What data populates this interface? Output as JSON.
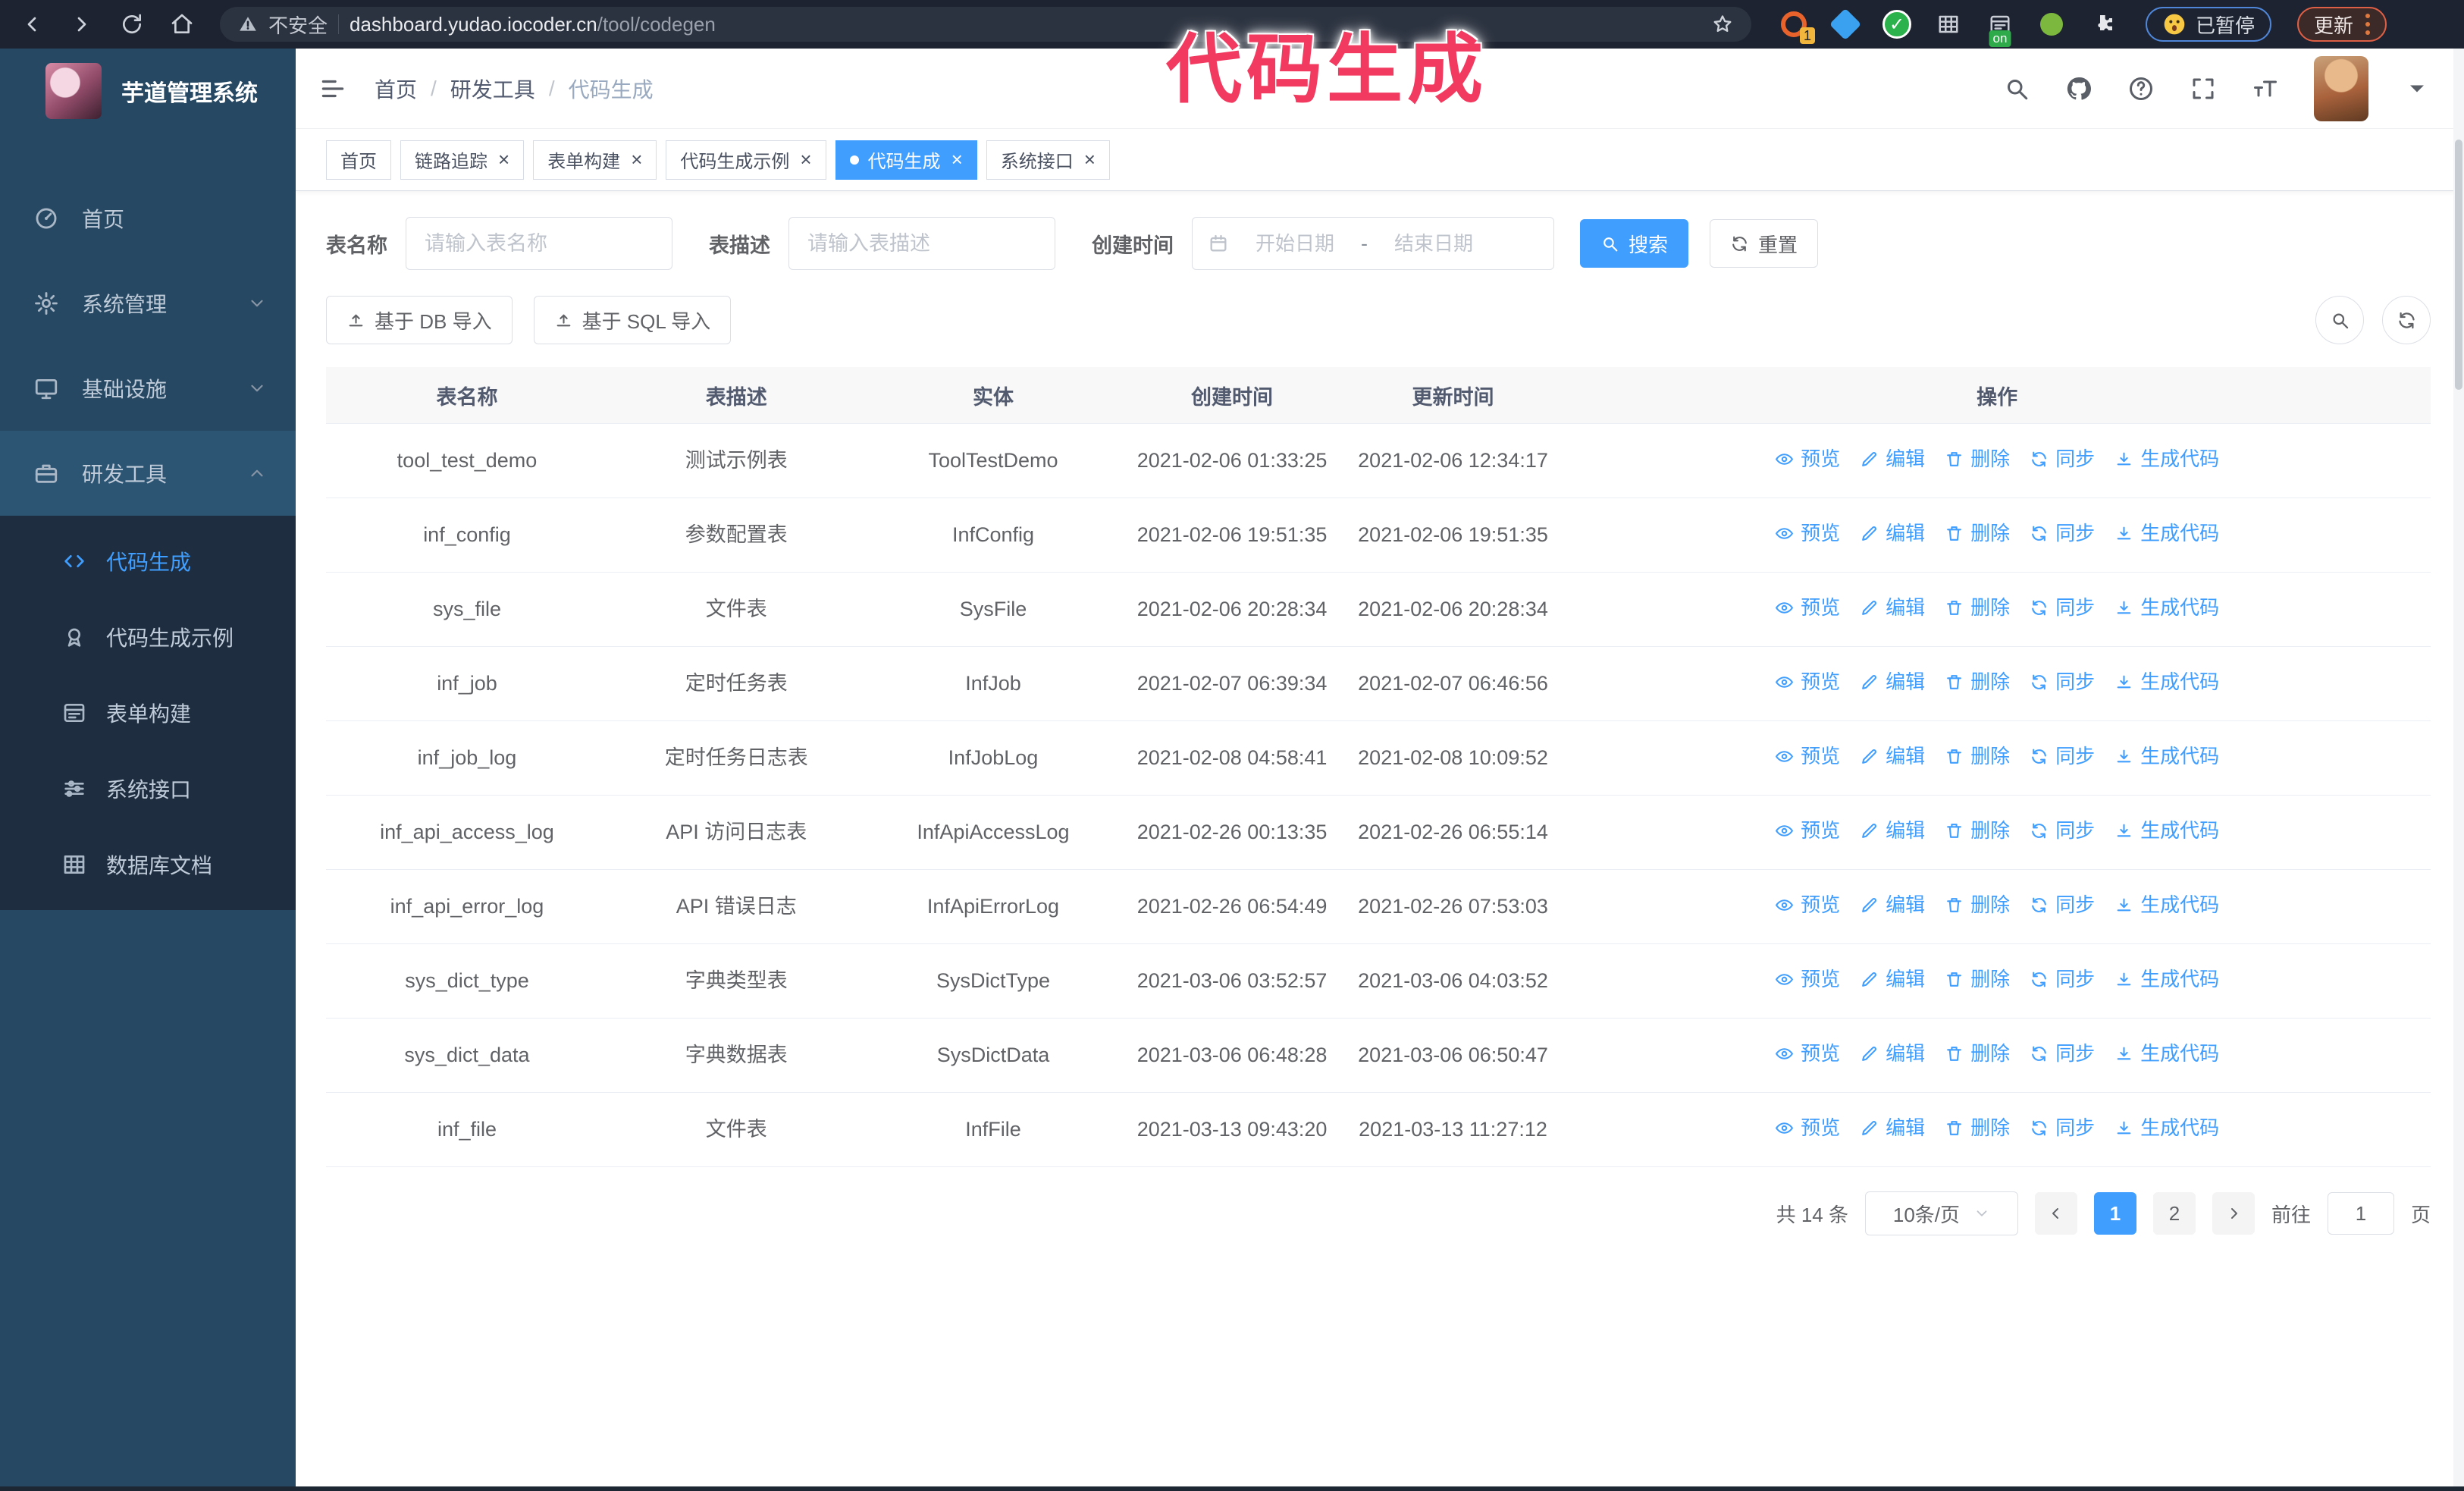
{
  "overlay": {
    "label": "代码生成"
  },
  "colors": {
    "accent": "#409eff",
    "sidebar_bg": "#264863",
    "submenu_bg": "#1e2e40",
    "overlay_pink": "#f23a60",
    "active_tab_bg": "#409eff"
  },
  "browser": {
    "security_warning": "不安全",
    "url_host": "dashboard.yudao.iocoder.cn",
    "url_path": "/tool/codegen",
    "extension_badge_1": "1",
    "extension_on_badge": "on",
    "paused_badge": "已暂停",
    "update_button": "更新"
  },
  "sidebar": {
    "app_title": "芋道管理系统",
    "items": [
      {
        "key": "home",
        "label": "首页",
        "icon": "dashboard-icon",
        "chevron": ""
      },
      {
        "key": "system",
        "label": "系统管理",
        "icon": "gear-icon",
        "chevron": "down"
      },
      {
        "key": "infra",
        "label": "基础设施",
        "icon": "monitor-icon",
        "chevron": "down"
      },
      {
        "key": "devtools",
        "label": "研发工具",
        "icon": "briefcase-icon",
        "chevron": "up",
        "active": true
      }
    ],
    "submenu": [
      {
        "key": "codegen",
        "label": "代码生成",
        "icon": "code-icon",
        "active": true
      },
      {
        "key": "codegen-example",
        "label": "代码生成示例",
        "icon": "medal-icon",
        "active": false
      },
      {
        "key": "form-builder",
        "label": "表单构建",
        "icon": "form-icon",
        "active": false
      },
      {
        "key": "system-api",
        "label": "系统接口",
        "icon": "sliders-icon",
        "active": false
      },
      {
        "key": "db-doc",
        "label": "数据库文档",
        "icon": "table-grid-icon",
        "active": false
      }
    ]
  },
  "navbar": {
    "breadcrumb": [
      "首页",
      "研发工具",
      "代码生成"
    ]
  },
  "tabs": [
    {
      "key": "home",
      "label": "首页",
      "closable": false,
      "active": false
    },
    {
      "key": "tracer",
      "label": "链路追踪",
      "closable": true,
      "active": false
    },
    {
      "key": "form-builder",
      "label": "表单构建",
      "closable": true,
      "active": false
    },
    {
      "key": "codegen-example",
      "label": "代码生成示例",
      "closable": true,
      "active": false
    },
    {
      "key": "codegen",
      "label": "代码生成",
      "closable": true,
      "active": true
    },
    {
      "key": "system-api",
      "label": "系统接口",
      "closable": true,
      "active": false
    }
  ],
  "filters": {
    "table_name_label": "表名称",
    "table_name_placeholder": "请输入表名称",
    "table_desc_label": "表描述",
    "table_desc_placeholder": "请输入表描述",
    "create_time_label": "创建时间",
    "date_start_placeholder": "开始日期",
    "date_separator": "-",
    "date_end_placeholder": "结束日期",
    "search_button": "搜索",
    "reset_button": "重置",
    "import_db_button": "基于 DB 导入",
    "import_sql_button": "基于 SQL 导入"
  },
  "table": {
    "columns": [
      "表名称",
      "表描述",
      "实体",
      "创建时间",
      "更新时间",
      "操作"
    ],
    "actions": [
      "预览",
      "编辑",
      "删除",
      "同步",
      "生成代码"
    ],
    "rows": [
      {
        "name": "tool_test_demo",
        "desc": "测试示例表",
        "entity": "ToolTestDemo",
        "created": "2021-02-06 01:33:25",
        "updated": "2021-02-06 12:34:17"
      },
      {
        "name": "inf_config",
        "desc": "参数配置表",
        "entity": "InfConfig",
        "created": "2021-02-06 19:51:35",
        "updated": "2021-02-06 19:51:35"
      },
      {
        "name": "sys_file",
        "desc": "文件表",
        "entity": "SysFile",
        "created": "2021-02-06 20:28:34",
        "updated": "2021-02-06 20:28:34"
      },
      {
        "name": "inf_job",
        "desc": "定时任务表",
        "entity": "InfJob",
        "created": "2021-02-07 06:39:34",
        "updated": "2021-02-07 06:46:56"
      },
      {
        "name": "inf_job_log",
        "desc": "定时任务日志表",
        "entity": "InfJobLog",
        "created": "2021-02-08 04:58:41",
        "updated": "2021-02-08 10:09:52"
      },
      {
        "name": "inf_api_access_log",
        "desc": "API 访问日志表",
        "entity": "InfApiAccessLog",
        "created": "2021-02-26 00:13:35",
        "updated": "2021-02-26 06:55:14"
      },
      {
        "name": "inf_api_error_log",
        "desc": "API 错误日志",
        "entity": "InfApiErrorLog",
        "created": "2021-02-26 06:54:49",
        "updated": "2021-02-26 07:53:03"
      },
      {
        "name": "sys_dict_type",
        "desc": "字典类型表",
        "entity": "SysDictType",
        "created": "2021-03-06 03:52:57",
        "updated": "2021-03-06 04:03:52"
      },
      {
        "name": "sys_dict_data",
        "desc": "字典数据表",
        "entity": "SysDictData",
        "created": "2021-03-06 06:48:28",
        "updated": "2021-03-06 06:50:47"
      },
      {
        "name": "inf_file",
        "desc": "文件表",
        "entity": "InfFile",
        "created": "2021-03-13 09:43:20",
        "updated": "2021-03-13 11:27:12"
      }
    ]
  },
  "pagination": {
    "total_text": "共 14 条",
    "page_size": "10条/页",
    "pages": [
      "1",
      "2"
    ],
    "active_page": "1",
    "goto_label": "前往",
    "goto_value": "1",
    "goto_suffix": "页"
  }
}
